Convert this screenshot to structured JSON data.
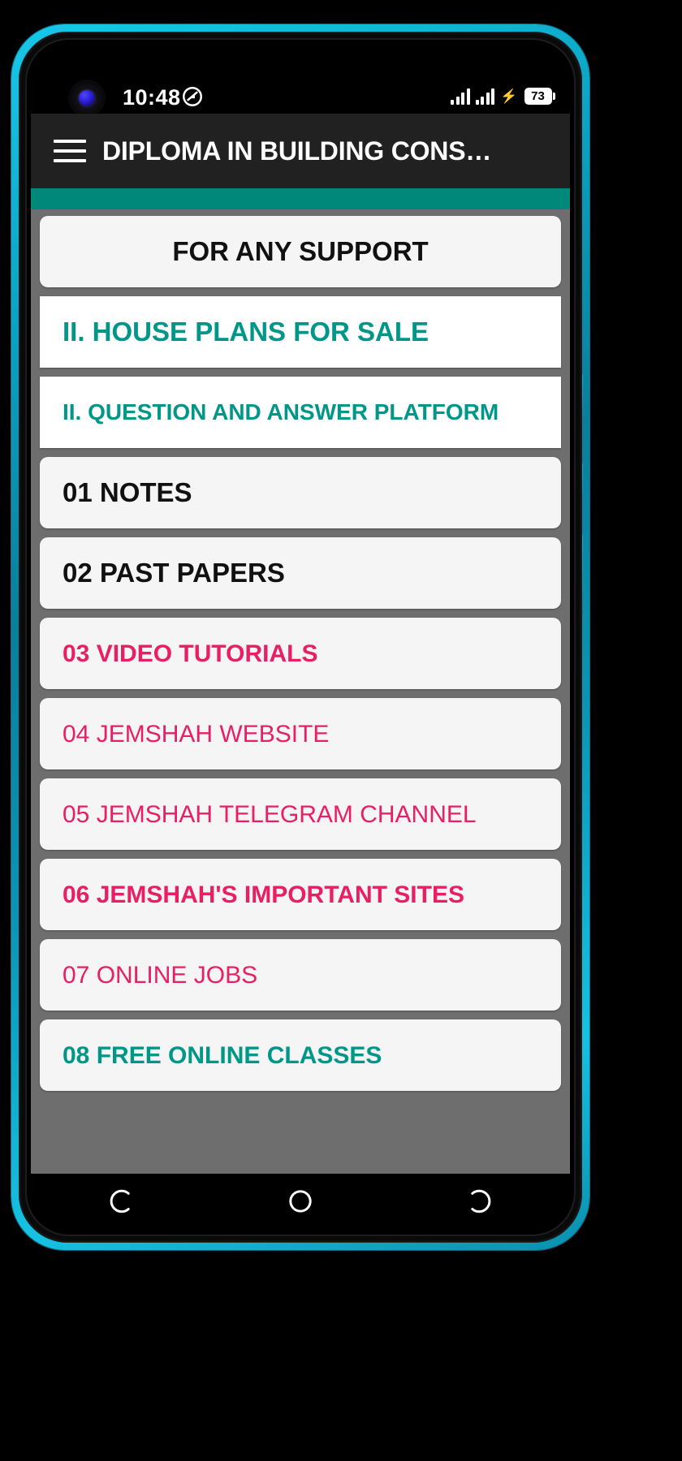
{
  "status_bar": {
    "time": "10:48",
    "left_icon": "do-not-disturb-icon",
    "camera_icon": "front-camera-punch-hole",
    "signal_icon_1": "signal-bars-sim1",
    "signal_icon_2": "signal-bars-sim2",
    "charging_icon": "charging-bolt-icon",
    "battery_level": "73"
  },
  "app_bar": {
    "menu_icon": "hamburger-menu-icon",
    "title": "DIPLOMA IN BUILDING CONS…"
  },
  "theme": {
    "accent_teal": "#00897b",
    "text_teal": "#009688",
    "text_pink": "#e91e63",
    "text_black": "#111111",
    "background_gray": "#6e6e6e",
    "card_offwhite": "#f5f5f5",
    "card_white": "#ffffff",
    "app_bar_dark": "#212121"
  },
  "menu_items": [
    {
      "label": "FOR ANY SUPPORT",
      "color": "c-black",
      "weight": "w-bold",
      "size": "size-lg",
      "align": "center",
      "card": "card",
      "name": "menu-item-support"
    },
    {
      "label": "II. HOUSE PLANS FOR SALE",
      "color": "c-teal",
      "weight": "w-bold",
      "size": "size-lg",
      "align": "left",
      "card": "card sharp",
      "name": "menu-item-house-plans"
    },
    {
      "label": "II. QUESTION AND ANSWER PLATFORM",
      "color": "c-teal",
      "weight": "w-bold",
      "size": "size-sm",
      "align": "left",
      "card": "card sharp",
      "name": "menu-item-qa-platform"
    },
    {
      "label": "01  NOTES",
      "color": "c-black",
      "weight": "w-bold",
      "size": "size-lg",
      "align": "left",
      "card": "card",
      "name": "menu-item-notes"
    },
    {
      "label": "02 PAST PAPERS",
      "color": "c-black",
      "weight": "w-bold",
      "size": "size-lg",
      "align": "left",
      "card": "card",
      "name": "menu-item-past-papers"
    },
    {
      "label": "03 VIDEO TUTORIALS",
      "color": "c-pink",
      "weight": "w-bold",
      "size": "size-md",
      "align": "left",
      "card": "card",
      "name": "menu-item-video-tutorials"
    },
    {
      "label": "04 JEMSHAH WEBSITE",
      "color": "c-pink",
      "weight": "w-regular",
      "size": "size-md",
      "align": "left",
      "card": "card",
      "name": "menu-item-jemshah-website"
    },
    {
      "label": "05 JEMSHAH TELEGRAM CHANNEL",
      "color": "c-pink",
      "weight": "w-regular",
      "size": "size-md",
      "align": "left",
      "card": "card",
      "name": "menu-item-telegram-channel"
    },
    {
      "label": "06 JEMSHAH'S IMPORTANT SITES",
      "color": "c-pink",
      "weight": "w-bold",
      "size": "size-md",
      "align": "left",
      "card": "card",
      "name": "menu-item-important-sites"
    },
    {
      "label": "07 ONLINE JOBS",
      "color": "c-pink",
      "weight": "w-regular",
      "size": "size-md",
      "align": "left",
      "card": "card",
      "name": "menu-item-online-jobs"
    },
    {
      "label": "08 FREE ONLINE CLASSES",
      "color": "c-teal",
      "weight": "w-bold",
      "size": "size-md",
      "align": "left",
      "card": "card",
      "name": "menu-item-free-online-classes"
    }
  ],
  "nav_bar": {
    "back_icon": "back-navigation-icon",
    "home_icon": "home-navigation-icon",
    "recents_icon": "recents-navigation-icon"
  }
}
